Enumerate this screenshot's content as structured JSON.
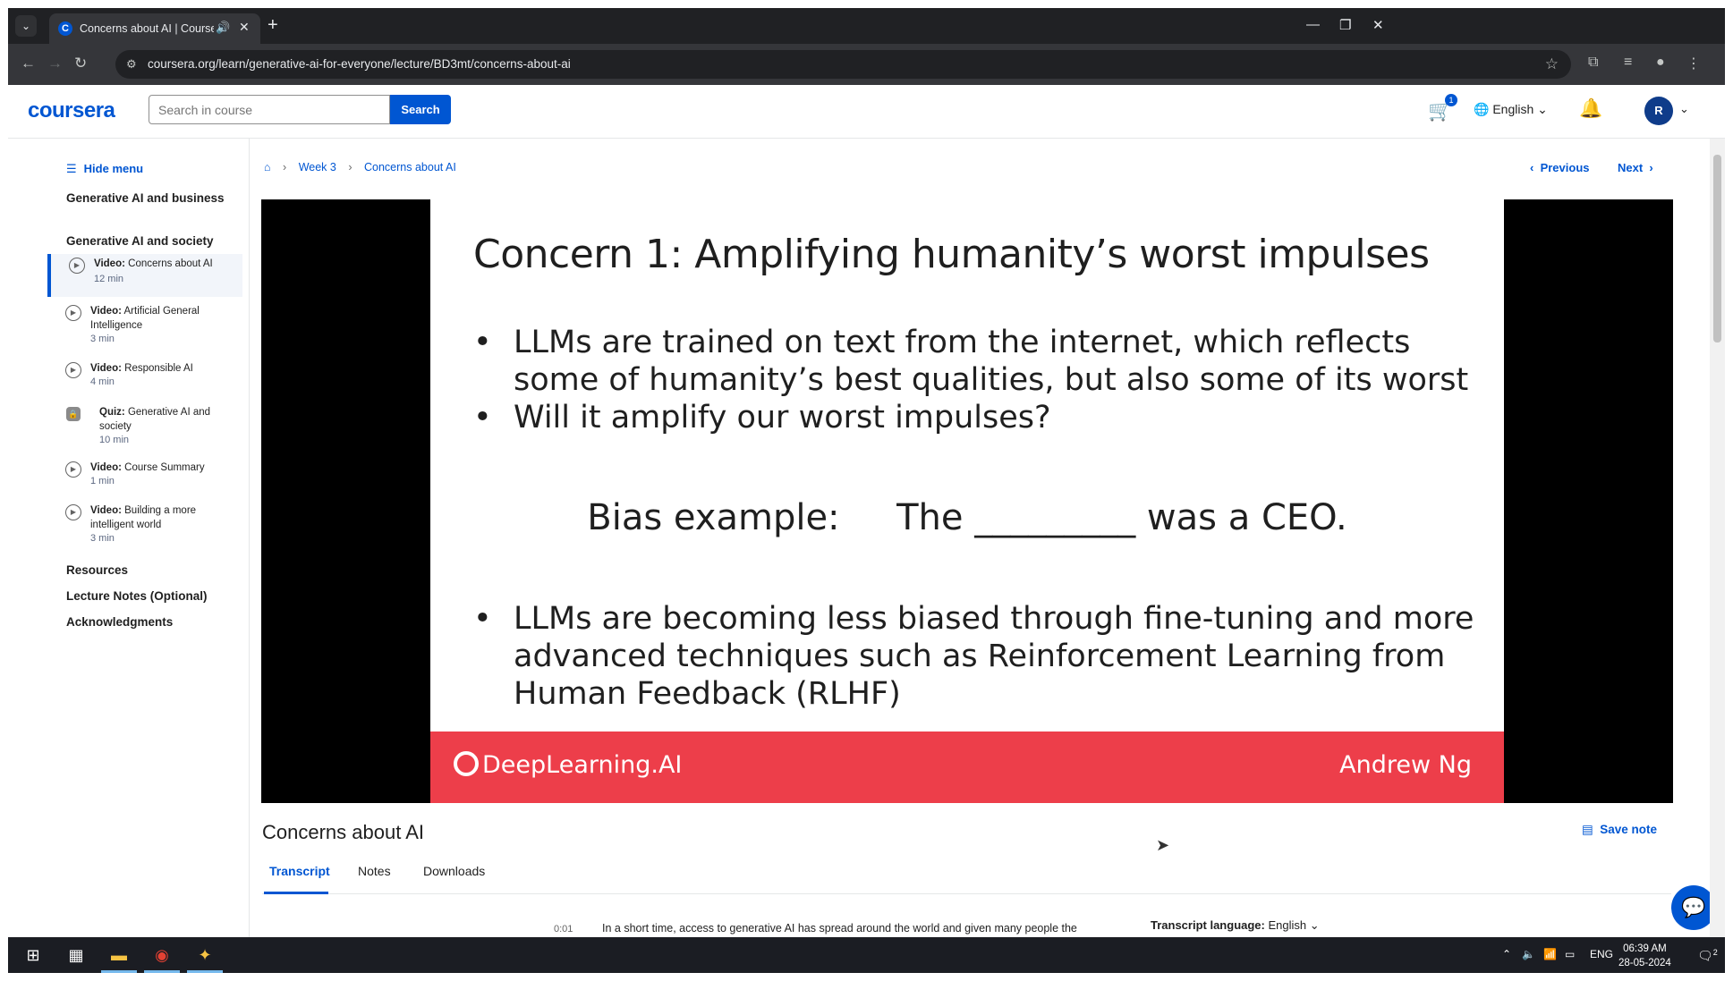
{
  "browser": {
    "tab_title": "Concerns about AI | Coursera",
    "tab_favicon": "C",
    "url": "coursera.org/learn/generative-ai-for-everyone/lecture/BD3mt/concerns-about-ai"
  },
  "header": {
    "logo": "coursera",
    "search_placeholder": "Search in course",
    "search_button": "Search",
    "cart_count": "1",
    "language": "English",
    "avatar_initial": "R"
  },
  "sidebar": {
    "hide_menu": "Hide menu",
    "sections": [
      "Generative AI and business",
      "Generative AI and society"
    ],
    "items": [
      {
        "type": "Video:",
        "title": "Concerns about AI",
        "duration": "12 min"
      },
      {
        "type": "Video:",
        "title": "Artificial General Intelligence",
        "duration": "3 min"
      },
      {
        "type": "Video:",
        "title": "Responsible AI",
        "duration": "4 min"
      },
      {
        "type": "Quiz:",
        "title": "Generative AI and society",
        "duration": "10 min"
      },
      {
        "type": "Video:",
        "title": "Course Summary",
        "duration": "1 min"
      },
      {
        "type": "Video:",
        "title": "Building a more intelligent world",
        "duration": "3 min"
      }
    ],
    "footer_links": [
      "Resources",
      "Lecture Notes (Optional)",
      "Acknowledgments"
    ]
  },
  "breadcrumb": {
    "week": "Week 3",
    "current": "Concerns about AI"
  },
  "nav": {
    "previous": "Previous",
    "next": "Next"
  },
  "slide": {
    "title": "Concern 1: Amplifying humanity’s worst impulses",
    "bullets": [
      "LLMs are trained on text from the internet, which reflects some of humanity’s best qualities, but also some of its worst",
      "Will it amplify our worst impulses?",
      "LLMs are becoming less biased through fine-tuning and more advanced techniques such as Reinforcement Learning from Human Feedback (RLHF)"
    ],
    "bias_example": "Bias example:     The _________ was a CEO.",
    "brand": "DeepLearning.AI",
    "presenter": "Andrew Ng"
  },
  "lecture": {
    "title": "Concerns about AI",
    "save_note": "Save note",
    "tabs": [
      "Transcript",
      "Notes",
      "Downloads"
    ],
    "transcript_time": "0:01",
    "transcript_text": "In a short time, access to generative AI has spread around the world and given many people the",
    "transcript_language_label": "Transcript language:",
    "transcript_language": "English"
  },
  "taskbar": {
    "lang": "ENG",
    "time": "06:39 AM",
    "date": "28-05-2024",
    "notifications": "2"
  }
}
